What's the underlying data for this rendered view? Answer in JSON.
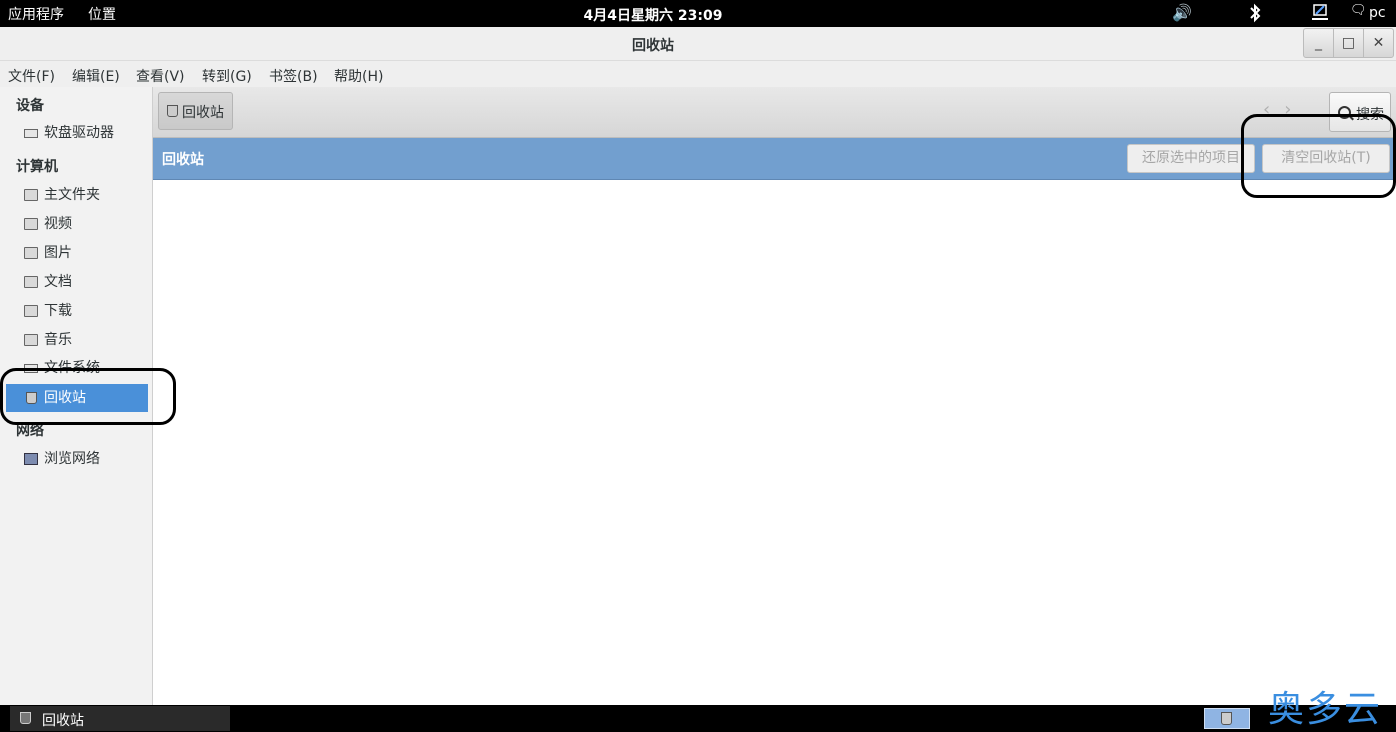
{
  "top_panel": {
    "menus": [
      "应用程序",
      "位置"
    ],
    "clock": "4月4日星期六 23:09",
    "user": "pc"
  },
  "window": {
    "title": "回收站",
    "minimize": "_",
    "maximize": "□",
    "close": "✕"
  },
  "menubar": [
    "文件(F)",
    "编辑(E)",
    "查看(V)",
    "转到(G)",
    "书签(B)",
    "帮助(H)"
  ],
  "sidebar": {
    "sections": [
      {
        "header": "设备",
        "items": [
          {
            "label": "软盘驱动器",
            "icon": "floppy-drive-icon"
          }
        ]
      },
      {
        "header": "计算机",
        "items": [
          {
            "label": "主文件夹",
            "icon": "home-folder-icon"
          },
          {
            "label": "视频",
            "icon": "video-folder-icon"
          },
          {
            "label": "图片",
            "icon": "pictures-folder-icon"
          },
          {
            "label": "文档",
            "icon": "documents-folder-icon"
          },
          {
            "label": "下载",
            "icon": "download-folder-icon"
          },
          {
            "label": "音乐",
            "icon": "music-folder-icon"
          },
          {
            "label": "文件系统",
            "icon": "filesystem-icon"
          },
          {
            "label": "回收站",
            "icon": "trash-icon",
            "selected": true
          }
        ]
      },
      {
        "header": "网络",
        "items": [
          {
            "label": "浏览网络",
            "icon": "network-icon"
          }
        ]
      }
    ]
  },
  "toolbar": {
    "path_label": "回收站",
    "search_label": "搜索"
  },
  "infobar": {
    "label": "回收站",
    "restore_label": "还原选中的项目",
    "empty_label": "清空回收站(T)"
  },
  "bottom_panel": {
    "task_label": "回收站"
  },
  "watermark": "奥多云",
  "colors": {
    "accent": "#4a90d9",
    "infobar": "#729fcf"
  }
}
